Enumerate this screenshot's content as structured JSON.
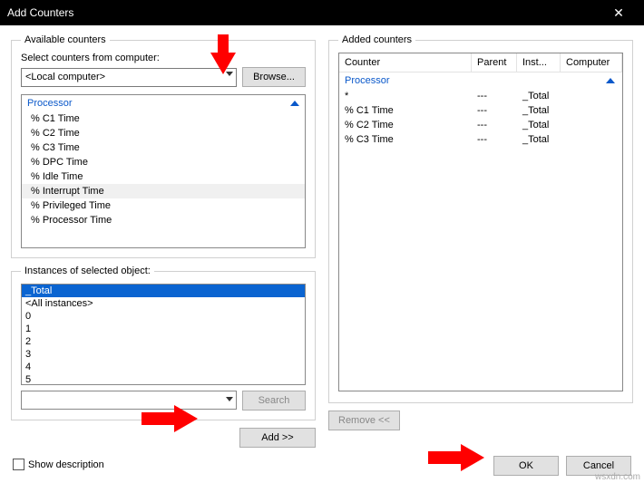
{
  "window": {
    "title": "Add Counters"
  },
  "available": {
    "legend": "Available counters",
    "select_label": "Select counters from computer:",
    "computer": "<Local computer>",
    "browse": "Browse...",
    "group": "Processor",
    "counters": [
      "% C1 Time",
      "% C2 Time",
      "% C3 Time",
      "% DPC Time",
      "% Idle Time",
      "% Interrupt Time",
      "% Privileged Time",
      "% Processor Time"
    ],
    "instances_label": "Instances of selected object:",
    "instances": [
      "_Total",
      "<All instances>",
      "0",
      "1",
      "2",
      "3",
      "4",
      "5"
    ],
    "search": "Search",
    "add": "Add >>"
  },
  "added": {
    "legend": "Added counters",
    "cols": {
      "counter": "Counter",
      "parent": "Parent",
      "inst": "Inst...",
      "computer": "Computer"
    },
    "group": "Processor",
    "rows": [
      {
        "counter": "*",
        "parent": "---",
        "inst": "_Total",
        "computer": ""
      },
      {
        "counter": "% C1 Time",
        "parent": "---",
        "inst": "_Total",
        "computer": ""
      },
      {
        "counter": "% C2 Time",
        "parent": "---",
        "inst": "_Total",
        "computer": ""
      },
      {
        "counter": "% C3 Time",
        "parent": "---",
        "inst": "_Total",
        "computer": ""
      }
    ],
    "remove": "Remove <<"
  },
  "footer": {
    "show_desc": "Show description",
    "ok": "OK",
    "cancel": "Cancel"
  },
  "watermark": "wsxdn.com"
}
